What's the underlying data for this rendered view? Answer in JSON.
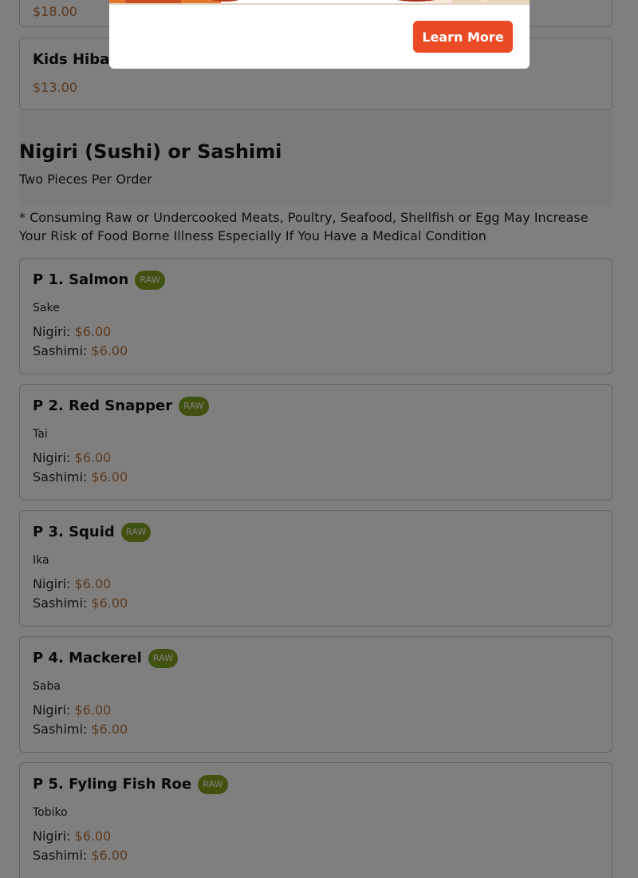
{
  "previous_section": {
    "partial_item": {
      "price": "$18.00"
    },
    "kids_item": {
      "name": "Kids Hibachi",
      "price": "$13.00"
    }
  },
  "section": {
    "title": "Nigiri (Sushi) or Sashimi",
    "subtitle": "Two Pieces Per Order",
    "note": "* Consuming Raw or Undercooked Meats, Poultry, Seafood, Shellfish or Egg May Increase Your Risk of Food Borne Illness Especially If You Have a Medical Condition"
  },
  "labels": {
    "nigiri": "Nigiri: ",
    "sashimi": "Sashimi: "
  },
  "items": [
    {
      "name": "P 1. Salmon",
      "badge": "RAW",
      "japanese": "Sake",
      "nigiri_price": "$6.00",
      "sashimi_price": "$6.00"
    },
    {
      "name": "P 2. Red Snapper",
      "badge": "RAW",
      "japanese": "Tai",
      "nigiri_price": "$6.00",
      "sashimi_price": "$6.00"
    },
    {
      "name": "P 3. Squid",
      "badge": "RAW",
      "japanese": "Ika",
      "nigiri_price": "$6.00",
      "sashimi_price": "$6.00"
    },
    {
      "name": "P 4. Mackerel",
      "badge": "RAW",
      "japanese": "Saba",
      "nigiri_price": "$6.00",
      "sashimi_price": "$6.00"
    },
    {
      "name": "P 5. Fyling Fish Roe",
      "badge": "RAW",
      "japanese": "Tobiko",
      "nigiri_price": "$6.00",
      "sashimi_price": "$6.00"
    }
  ],
  "modal": {
    "button_label": "Learn More"
  },
  "colors": {
    "overlay": "rgba(0,0,0,0.5)",
    "accent_button": "#ea4b25",
    "price": "#b8733a",
    "raw_badge": "#82a521"
  }
}
